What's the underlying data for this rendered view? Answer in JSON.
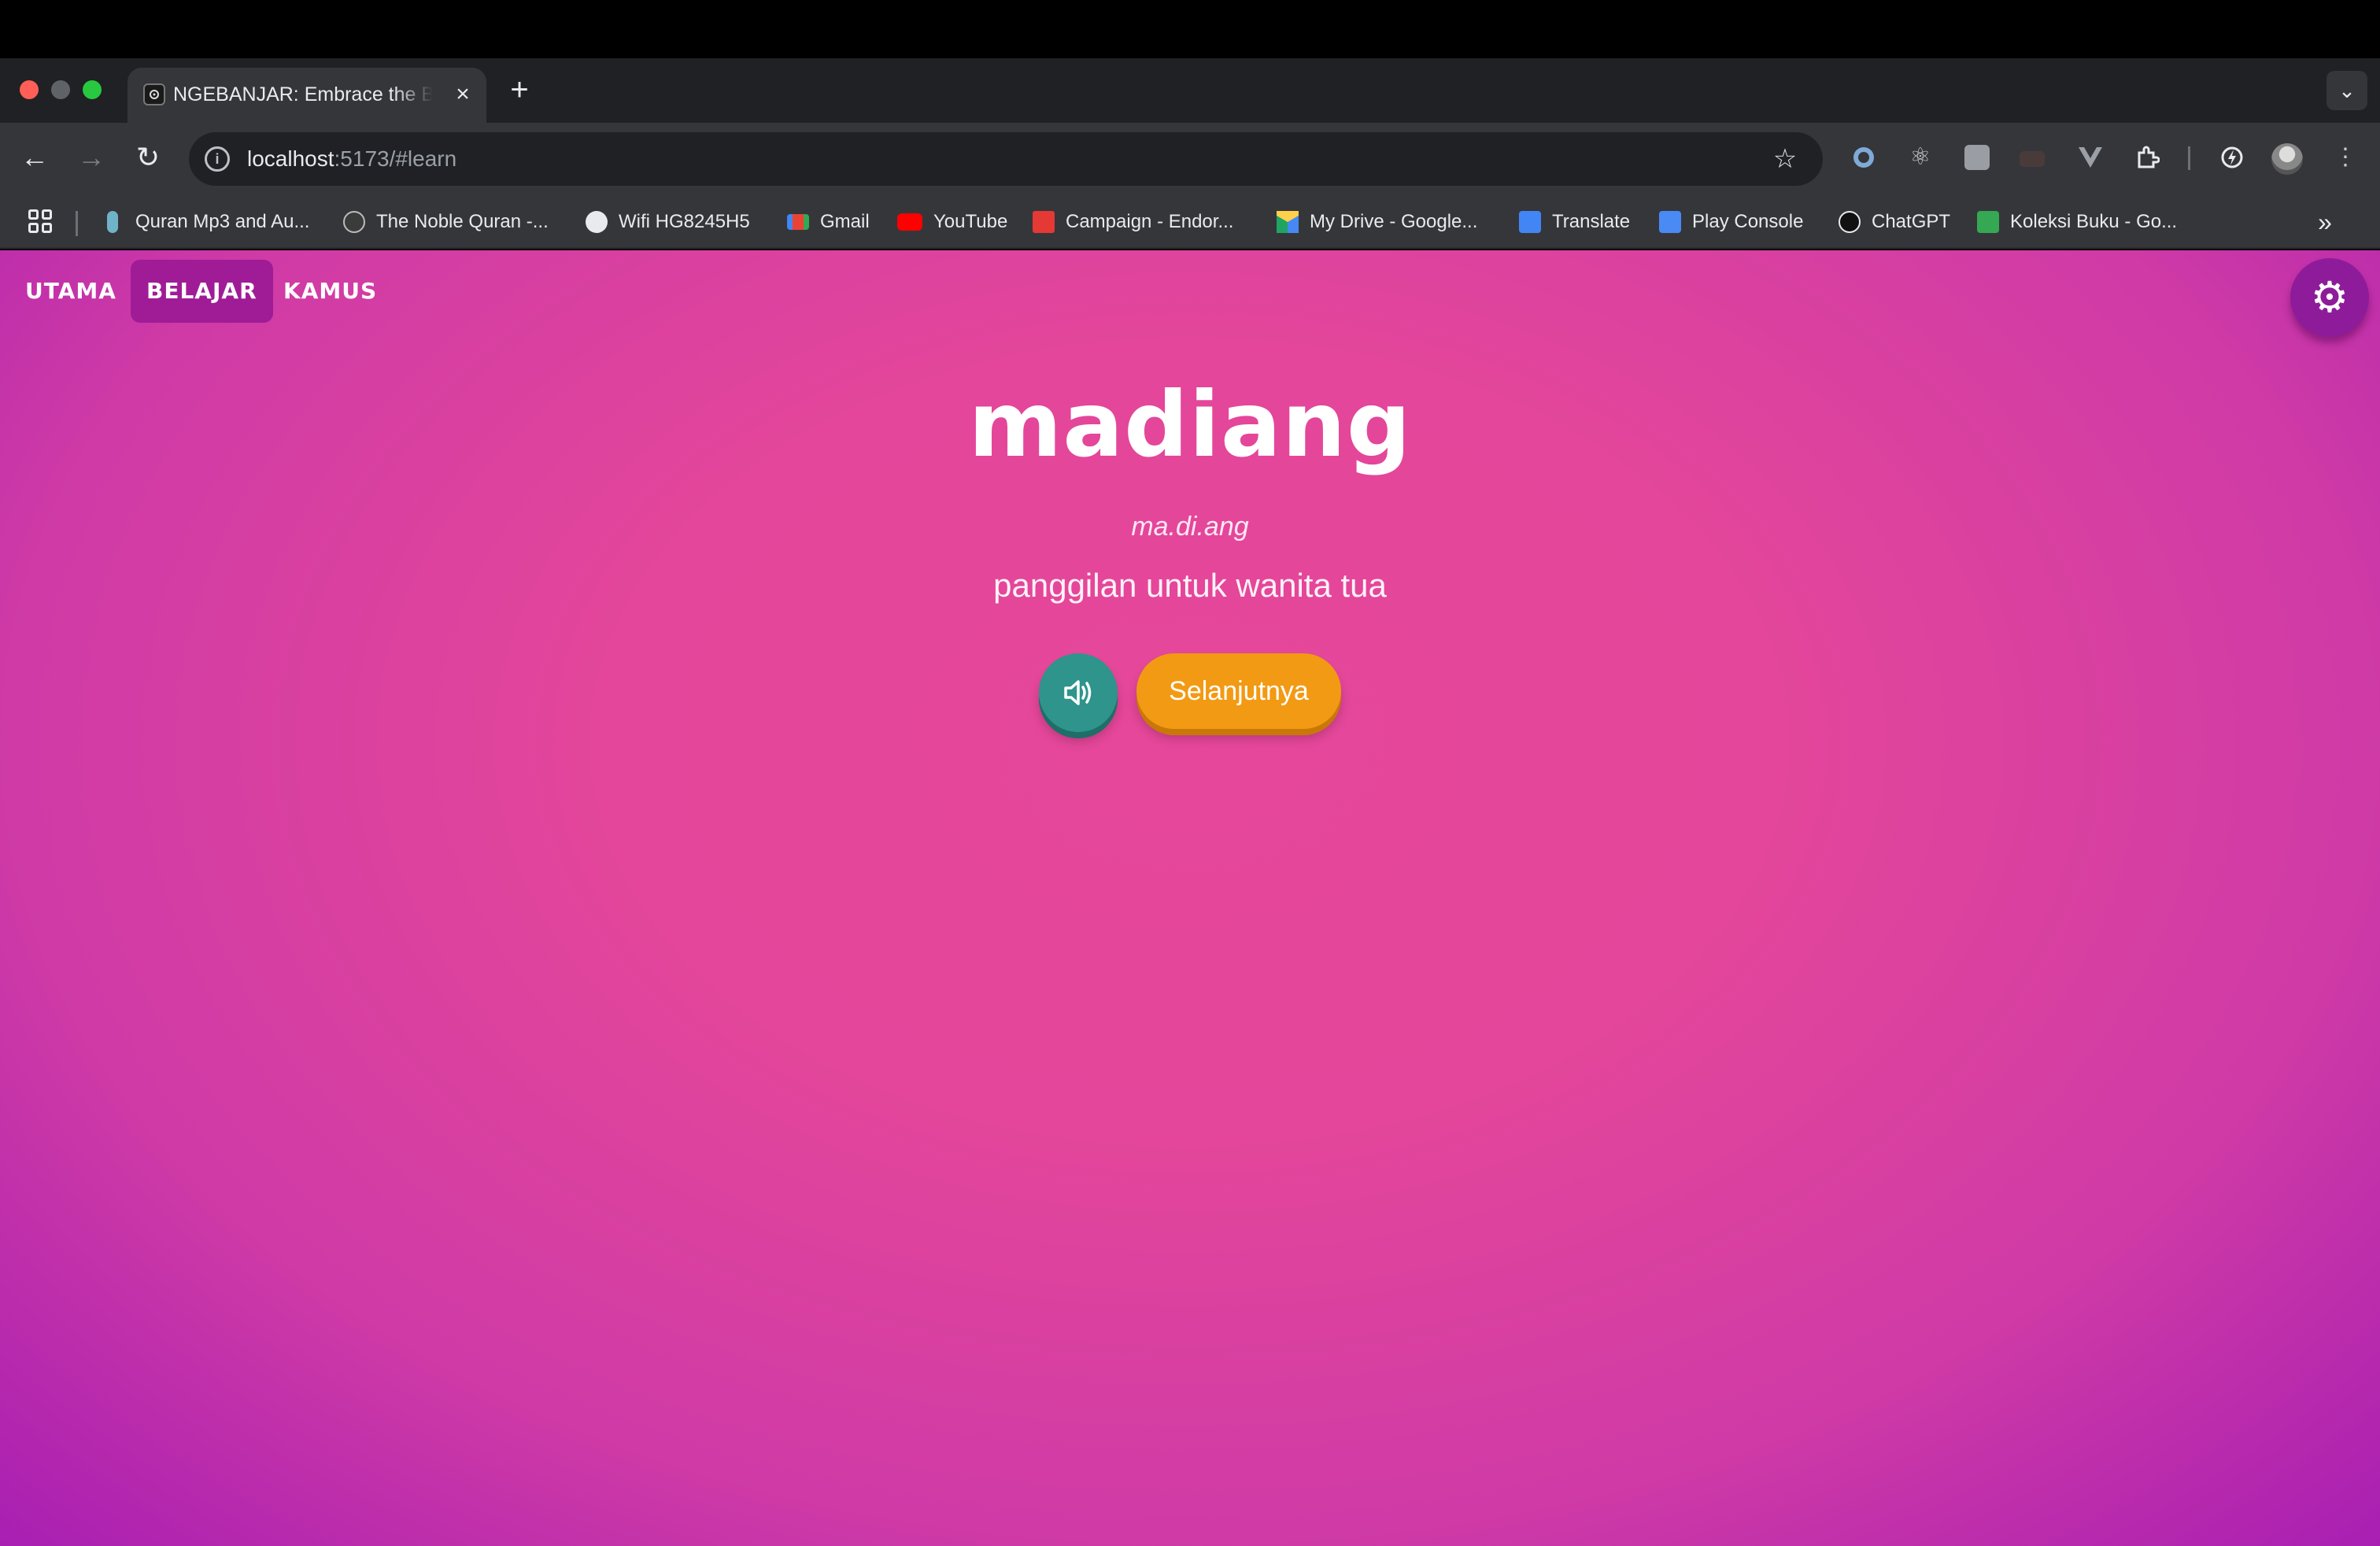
{
  "browser": {
    "tab": {
      "title": "NGEBANJAR: Embrace the Be",
      "close_icon": "×"
    },
    "new_tab_icon": "+",
    "tab_search_icon": "⌄",
    "url_host": "localhost",
    "url_path": ":5173/#learn",
    "bookmarks": [
      {
        "label": "Quran Mp3 and Au...",
        "icon_color": "#6fb3c9"
      },
      {
        "label": "The Noble Quran -...",
        "icon_color": "#3b3b3b"
      },
      {
        "label": "Wifi HG8245H5",
        "icon_color": "#e8eaed"
      },
      {
        "label": "Gmail",
        "icon_color": "#ea4335"
      },
      {
        "label": "YouTube",
        "icon_color": "#ff0000"
      },
      {
        "label": "Campaign - Endor...",
        "icon_color": "#e53935"
      },
      {
        "label": "My Drive - Google...",
        "icon_color": "#1fa463"
      },
      {
        "label": "Translate",
        "icon_color": "#4285f4"
      },
      {
        "label": "Play Console",
        "icon_color": "#4a8af4"
      },
      {
        "label": "ChatGPT",
        "icon_color": "#111111"
      },
      {
        "label": "Koleksi Buku - Go...",
        "icon_color": "#34a853"
      }
    ],
    "more_bookmarks_icon": "»"
  },
  "app": {
    "nav": {
      "utama": "UTAMA",
      "belajar": "BELAJAR",
      "kamus": "KAMUS"
    },
    "active_nav": "BELAJAR",
    "settings_icon": "⚙",
    "card": {
      "word": "madiang",
      "syllables": "ma.di.ang",
      "meaning": "panggilan untuk wanita tua",
      "next_label": "Selanjutnya"
    },
    "colors": {
      "background": "#e3469a",
      "active_nav": "#a01c96",
      "sound_button": "#2e948c",
      "next_button": "#f29a13"
    }
  }
}
